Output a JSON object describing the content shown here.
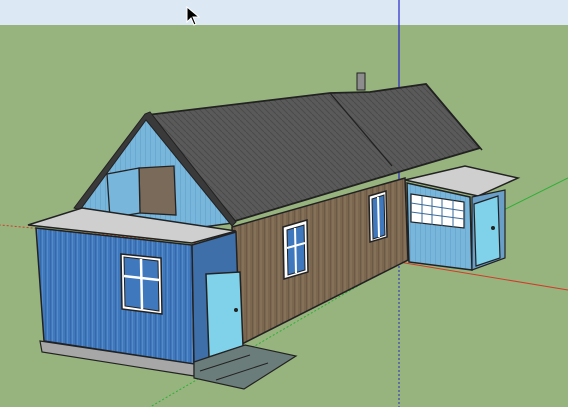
{
  "viewport": {
    "sky_color": "#dce9f5",
    "ground_color": "#97b47e",
    "cursor_icon": "arrow-cursor-icon"
  },
  "axes": {
    "x_color": "#d33a2a",
    "y_color": "#2fae3a",
    "z_color": "#2727c8"
  },
  "model": {
    "siding_blue": "#3f78bd",
    "siding_light": "#78b6dc",
    "wood": "#7b6650",
    "roof": "#5a5a5a",
    "door": "#7fd2ea",
    "foundation": "#a7a7a7"
  }
}
